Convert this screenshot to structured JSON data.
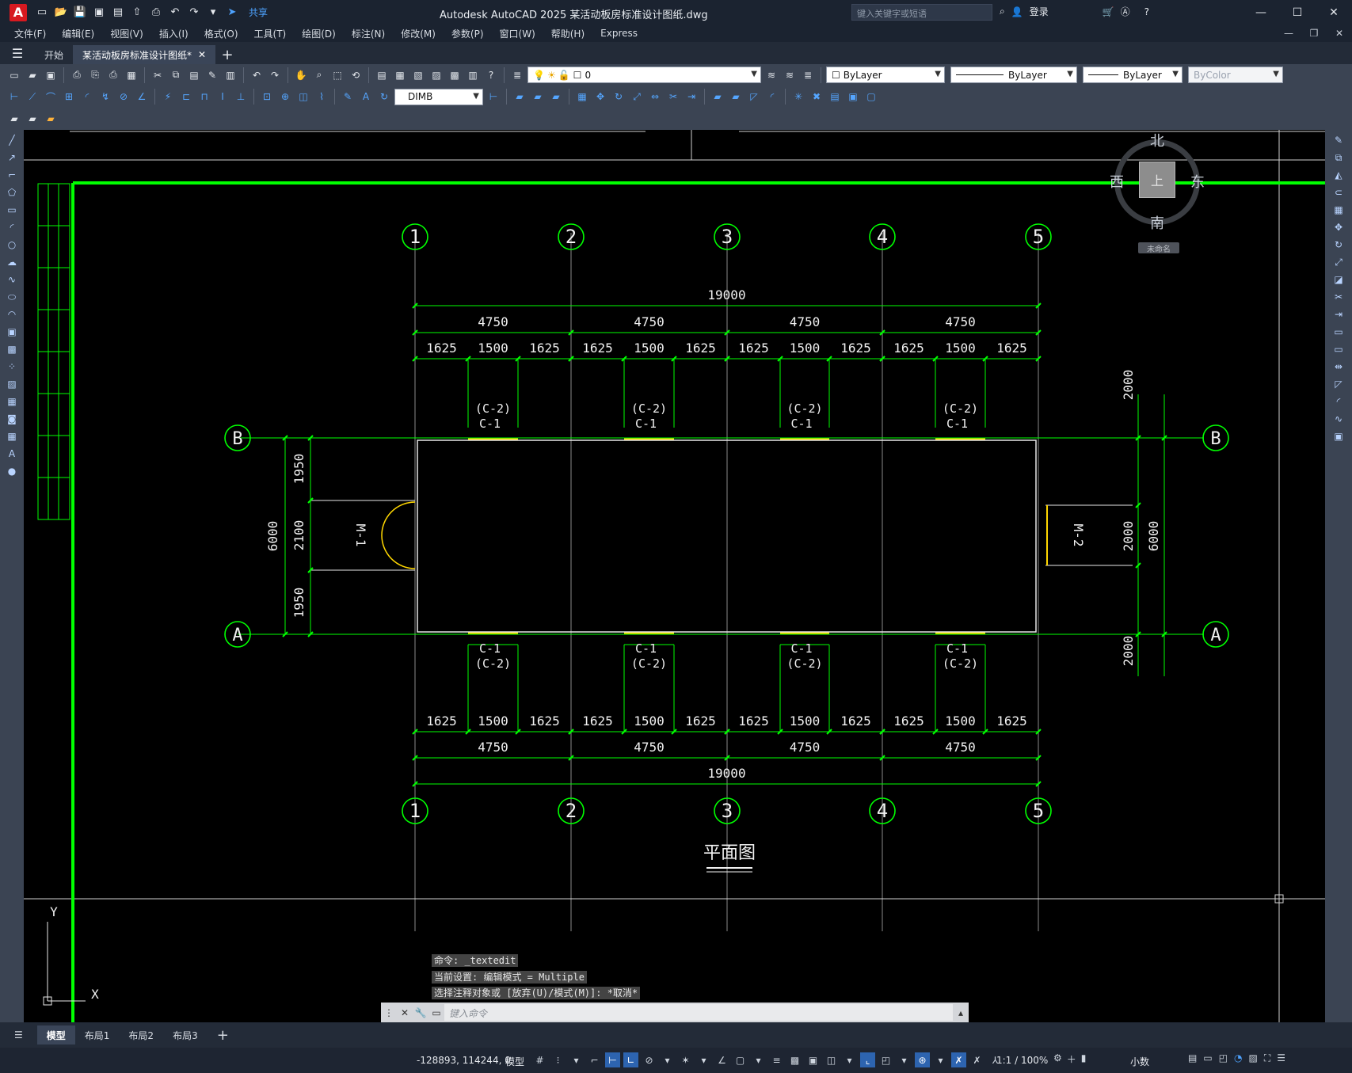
{
  "titlebar": {
    "logo": "A",
    "share_label": "共享",
    "title": "Autodesk AutoCAD 2025    某活动板房标准设计图纸.dwg",
    "search_placeholder": "键入关键字或短语",
    "login_label": "登录",
    "minimize": "—",
    "maximize": "☐",
    "close": "✕"
  },
  "menubar": {
    "items": [
      "文件(F)",
      "编辑(E)",
      "视图(V)",
      "插入(I)",
      "格式(O)",
      "工具(T)",
      "绘图(D)",
      "标注(N)",
      "修改(M)",
      "参数(P)",
      "窗口(W)",
      "帮助(H)",
      "Express"
    ]
  },
  "tabs": {
    "start": "开始",
    "doc": "某活动板房标准设计图纸*",
    "close": "✕",
    "add": "+"
  },
  "toolbar": {
    "layer_value": "0",
    "color_value": "ByLayer",
    "linetype_value": "ByLayer",
    "lineweight_value": "ByLayer",
    "plotstyle_value": "ByColor",
    "dimstyle_value": "DIMB"
  },
  "viewcube": {
    "north": "北",
    "south": "南",
    "east": "东",
    "west": "西",
    "top": "上",
    "ucs": "未命名"
  },
  "drawing": {
    "axes_cols": [
      "1",
      "2",
      "3",
      "4",
      "5"
    ],
    "axes_rows": [
      "A",
      "B"
    ],
    "dim_total": "19000",
    "dim_bay": "4750",
    "dim_a": "1625",
    "dim_b": "1500",
    "win_top_1": "(C-2)",
    "win_top_2": "C-1",
    "win_bot_1": "C-1",
    "win_bot_2": "(C-2)",
    "left_dims": [
      "6000",
      "1950",
      "2100",
      "1950"
    ],
    "right_dims": [
      "2000",
      "6000",
      "2000",
      "2000"
    ],
    "door_left": "M-1",
    "door_right": "M-2",
    "plan_title": "平面图",
    "ucs_x": "X",
    "ucs_y": "Y"
  },
  "command": {
    "line1": "命令: _textedit",
    "line2": "当前设置: 编辑模式 = Multiple",
    "line3": "选择注释对象或 [放弃(U)/模式(M)]: *取消*",
    "placeholder": "键入命令"
  },
  "layouttabs": {
    "model": "模型",
    "layout1": "布局1",
    "layout2": "布局2",
    "layout3": "布局3",
    "add": "+"
  },
  "statusbar": {
    "coords": "-128893, 114244, 0",
    "model": "模型",
    "scale": "1:1 / 100%",
    "units": "小数"
  },
  "colors": {
    "accent_green": "#00ff00",
    "door_yellow": "#ffd700"
  }
}
